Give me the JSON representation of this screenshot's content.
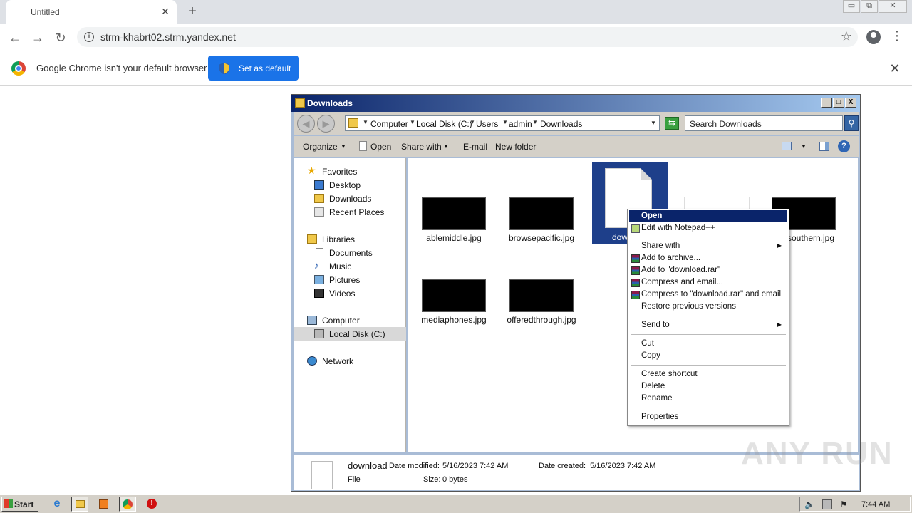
{
  "browser": {
    "tab_title": "Untitled",
    "tab_close": "✕",
    "new_tab": "+",
    "url": "strm-khabrt02.strm.yandex.net",
    "window_controls": [
      "▭",
      "⧉",
      "✕"
    ]
  },
  "infobar": {
    "message": "Google Chrome isn't your default browser",
    "button": "Set as default",
    "close": "✕"
  },
  "explorer": {
    "title": "Downloads",
    "title_buttons": [
      "_",
      "□",
      "X"
    ],
    "breadcrumbs": [
      "Computer",
      "Local Disk (C:)",
      "Users",
      "admin",
      "Downloads"
    ],
    "search_placeholder": "Search Downloads",
    "commands": {
      "organize": "Organize",
      "open": "Open",
      "share_with": "Share with",
      "email": "E-mail",
      "new_folder": "New folder",
      "help": "?"
    },
    "nav": {
      "favorites": "Favorites",
      "desktop": "Desktop",
      "downloads": "Downloads",
      "recent": "Recent Places",
      "libraries": "Libraries",
      "documents": "Documents",
      "music": "Music",
      "pictures": "Pictures",
      "videos": "Videos",
      "computer": "Computer",
      "local_disk": "Local Disk (C:)",
      "network": "Network"
    },
    "files": {
      "f1": "ablemiddle.jpg",
      "f2": "browsepacific.jpg",
      "selected": "dow",
      "f4": "southern.jpg",
      "f5": "mediaphones.jpg",
      "f6": "offeredthrough.jpg"
    },
    "details": {
      "name": "download",
      "type": "File",
      "modified_label": "Date modified:",
      "modified": "5/16/2023 7:42 AM",
      "created_label": "Date created:",
      "created": "5/16/2023 7:42 AM",
      "size_label": "Size:",
      "size": "0 bytes"
    }
  },
  "context_menu": {
    "open": "Open",
    "notepad": "Edit with Notepad++",
    "share_with": "Share with",
    "add_archive": "Add to archive...",
    "add_rar": "Add to \"download.rar\"",
    "compress_email": "Compress and email...",
    "compress_rar_email": "Compress to \"download.rar\" and email",
    "restore": "Restore previous versions",
    "send_to": "Send to",
    "cut": "Cut",
    "copy": "Copy",
    "create_shortcut": "Create shortcut",
    "delete": "Delete",
    "rename": "Rename",
    "properties": "Properties"
  },
  "watermark": "ANY RUN",
  "taskbar": {
    "start": "Start",
    "clock": "7:44 AM"
  }
}
